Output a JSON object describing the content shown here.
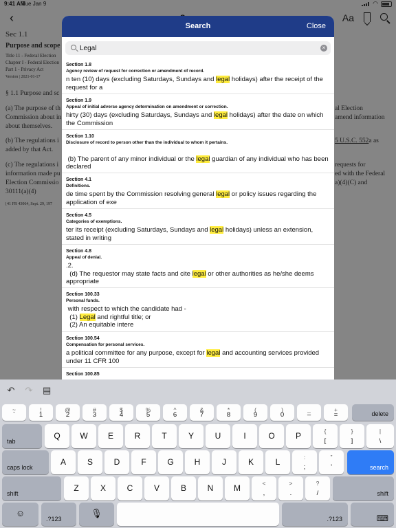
{
  "status": {
    "time": "9:41 AM",
    "date": "Tue Jan 9"
  },
  "doc": {
    "back_icon": "chevron-left-icon",
    "title_partial": "S",
    "text_size_label": "Aa",
    "section": "Sec 1.1",
    "purpose": "Purpose and scope",
    "title_line": "Title 11 - Federal Election",
    "chapter_line": "Chapter I - Federal Election",
    "part_line": "Part 1 - Privacy Act",
    "version": "Version | 2021-01-17",
    "heading": "§ 1.1 Purpose and sc",
    "para_a1": "(a) The purpose of th",
    "para_a2": "Commission about in",
    "para_a3": "about themselves.",
    "para_a_r1": "al Election",
    "para_a_r2": "amend information",
    "para_b1": "(b) The regulations i",
    "para_b2": "added by that Act.",
    "para_b_r1": "5 U.S.C. 552",
    "para_b_r2": "a as",
    "para_c1": "(c) The regulations i",
    "para_c2": "information made pu",
    "para_c3": "Election Commissio",
    "para_c4": "30111(a)(4)",
    "para_c_r1": "requests for",
    "para_c_r2": "ed with the Federal",
    "para_c_r3": "a)(4)(C) and",
    "citation": "[41 FR 43064, Sept. 29, 197"
  },
  "search": {
    "title": "Search",
    "close_label": "Close",
    "query": "Legal",
    "results": [
      {
        "section": "Section 1.8",
        "title": "Agency review of request for correction or amendment of record.",
        "pre": "n ten (10) days (excluding Saturdays, Sundays and ",
        "match": "legal",
        "post": " holidays) after the receipt of the request for a"
      },
      {
        "section": "Section 1.9",
        "title": "Appeal of initial adverse agency determination on amendment or correction.",
        "pre": "hirty (30) days (excluding Saturdays, Sundays and ",
        "match": "legal",
        "post": " holidays) after the date on which the Commission"
      },
      {
        "section": "Section 1.10",
        "title": "Disclosure of record to person other than the individual to whom it pertains.",
        "pre": "\n (b) The parent of any minor individual or the ",
        "match": "legal",
        "post": " guardian of any individual who has been declared"
      },
      {
        "section": "Section 4.1",
        "title": "Definitions.",
        "pre": "de time spent by the Commission resolving general ",
        "match": "legal",
        "post": " or policy issues regarding the application of exe"
      },
      {
        "section": "Section 4.5",
        "title": "Categories of exemptions.",
        "pre": "ter its receipt (excluding Saturdays, Sundays and ",
        "match": "legal",
        "post": " holidays) unless an extension, stated in writing"
      },
      {
        "section": "Section 4.8",
        "title": "Appeal of denial.",
        "pre": ".2.\n  (d) The requestor may state facts and cite ",
        "match": "legal",
        "post": " or other authorities as he/she deems appropriate"
      },
      {
        "section": "Section 100.33",
        "title": "Personal funds.",
        "pre": " with respect to which the candidate had -\n  (1) ",
        "match": "Legal",
        "post": " and rightful title; or\n  (2) An equitable intere"
      },
      {
        "section": "Section 100.54",
        "title": "Compensation for personal services.",
        "pre": "a political committee for any purpose, except for ",
        "match": "legal",
        "post": " and accounting services provided under 11 CFR 100"
      },
      {
        "section": "Section 100.85",
        "title": "",
        "pre": "",
        "match": "",
        "post": ""
      }
    ]
  },
  "keyboard": {
    "undo_icon": "undo-icon",
    "redo_icon": "redo-icon",
    "paste_icon": "paste-icon",
    "row1": [
      {
        "up": "~",
        "dn": "`"
      },
      {
        "up": "!",
        "dn": "1"
      },
      {
        "up": "@",
        "dn": "2"
      },
      {
        "up": "#",
        "dn": "3"
      },
      {
        "up": "$",
        "dn": "4"
      },
      {
        "up": "%",
        "dn": "5"
      },
      {
        "up": "^",
        "dn": "6"
      },
      {
        "up": "&",
        "dn": "7"
      },
      {
        "up": "*",
        "dn": "8"
      },
      {
        "up": "(",
        "dn": "9"
      },
      {
        "up": ")",
        "dn": "0"
      },
      {
        "up": "_",
        "dn": "–"
      },
      {
        "up": "+",
        "dn": "="
      }
    ],
    "delete_label": "delete",
    "tab_label": "tab",
    "row2": [
      "Q",
      "W",
      "E",
      "R",
      "T",
      "Y",
      "U",
      "I",
      "O",
      "P"
    ],
    "row2_sym": [
      {
        "up": "{",
        "dn": "["
      },
      {
        "up": "}",
        "dn": "]"
      },
      {
        "up": "|",
        "dn": "\\"
      }
    ],
    "caps_label": "caps lock",
    "row3": [
      "A",
      "S",
      "D",
      "F",
      "G",
      "H",
      "J",
      "K",
      "L"
    ],
    "row3_sym": [
      {
        "up": ":",
        "dn": ";"
      },
      {
        "up": "”",
        "dn": "’"
      }
    ],
    "search_label": "search",
    "shift_label": "shift",
    "row4": [
      "Z",
      "X",
      "C",
      "V",
      "B",
      "N",
      "M"
    ],
    "row4_sym": [
      {
        "up": "<",
        "dn": ","
      },
      {
        "up": ">",
        "dn": "."
      },
      {
        "up": "?",
        "dn": "/"
      }
    ],
    "emoji_icon": "emoji-icon",
    "num_label": ".?123",
    "mic_icon": "microphone-icon",
    "hide_icon": "keyboard-hide-icon"
  }
}
